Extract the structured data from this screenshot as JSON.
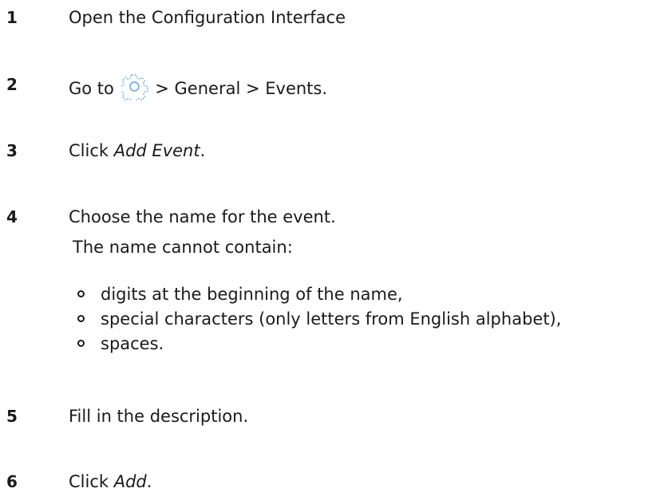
{
  "steps": [
    {
      "number": "1",
      "text": "Open the Configuration Interface"
    },
    {
      "number": "2",
      "prefix": "Go to",
      "icon": "gear-icon",
      "suffix": "> General > Events.",
      "icon_color": "#5aa0e6"
    },
    {
      "number": "3",
      "prefix": "Click ",
      "emphasis": "Add Event",
      "suffix": "."
    },
    {
      "number": "4",
      "text": "Choose the name for the event.",
      "note": "The name cannot contain:",
      "bullets": [
        "digits at the beginning of the name,",
        "special characters (only letters from English alphabet),",
        "spaces."
      ]
    },
    {
      "number": "5",
      "text": "Fill in the description."
    },
    {
      "number": "6",
      "prefix": "Click ",
      "emphasis": "Add",
      "suffix": "."
    }
  ]
}
